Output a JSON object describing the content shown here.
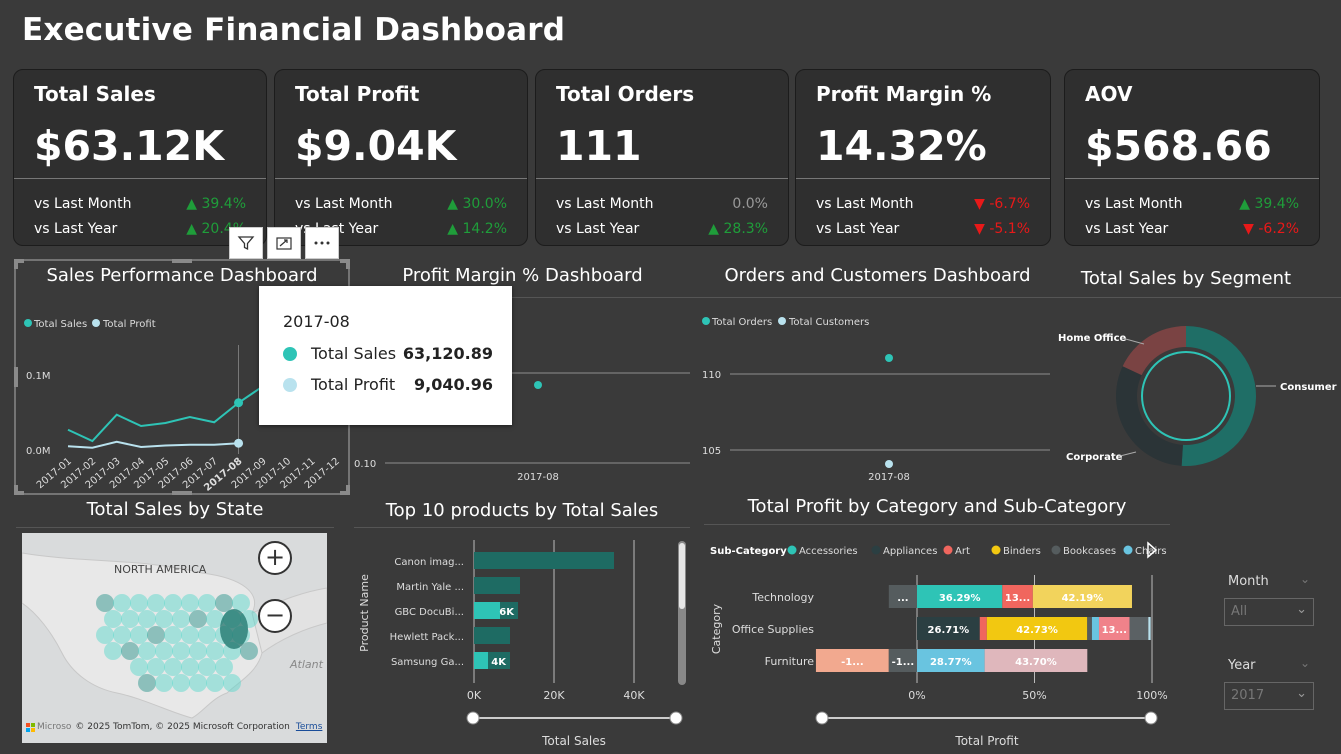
{
  "page_title": "Executive Financial Dashboard",
  "kpis": [
    {
      "title": "Total Sales",
      "value": "$63.12K",
      "m_label": "vs Last Month",
      "m_val": "39.4%",
      "m_dir": "up",
      "y_label": "vs Last Year",
      "y_val": "20.4%",
      "y_dir": "up"
    },
    {
      "title": "Total Profit",
      "value": "$9.04K",
      "m_label": "vs Last Month",
      "m_val": "30.0%",
      "m_dir": "up",
      "y_label": "vs Last Year",
      "y_val": "14.2%",
      "y_dir": "up"
    },
    {
      "title": "Total Orders",
      "value": "111",
      "m_label": "vs Last Month",
      "m_val": "0.0%",
      "m_dir": "flat",
      "y_label": "vs Last Year",
      "y_val": "28.3%",
      "y_dir": "up"
    },
    {
      "title": "Profit Margin %",
      "value": "14.32%",
      "m_label": "vs Last Month",
      "m_val": "-6.7%",
      "m_dir": "down",
      "y_label": "vs Last Year",
      "y_val": "-5.1%",
      "y_dir": "down"
    },
    {
      "title": "AOV",
      "value": "$568.66",
      "m_label": "vs Last Month",
      "m_val": "39.4%",
      "m_dir": "up",
      "y_label": "vs Last Year",
      "y_val": "-6.2%",
      "y_dir": "down"
    }
  ],
  "sections": {
    "sales_perf": "Sales Performance Dashboard",
    "profit_margin": "Profit Margin % Dashboard",
    "orders_customers": "Orders and Customers Dashboard",
    "segment": "Total Sales by Segment",
    "state": "Total Sales by State",
    "top10": "Top 10 products by Total Sales",
    "category": "Total Profit by Category and Sub-Category"
  },
  "tooltip": {
    "header": "2017-08",
    "rows": [
      {
        "name": "Total Sales",
        "value": "63,120.89",
        "color": "#2ec4b6"
      },
      {
        "name": "Total Profit",
        "value": "9,040.96",
        "color": "#b9e2ee"
      }
    ]
  },
  "visual_header_icons": [
    "filter-icon",
    "focus-mode-icon",
    "more-options-icon"
  ],
  "colors": {
    "teal": "#2ec4b6",
    "light_blue": "#b9e2ee",
    "dark_teal": "#1e6b63",
    "up": "#1f9d3a",
    "down": "#e81919"
  },
  "chart_data": [
    {
      "type": "line",
      "id": "sales_performance",
      "legend": [
        "Total Sales",
        "Total Profit"
      ],
      "categories": [
        "2017-01",
        "2017-02",
        "2017-03",
        "2017-04",
        "2017-05",
        "2017-06",
        "2017-07",
        "2017-08",
        "2017-09",
        "2017-10",
        "2017-11",
        "2017-12"
      ],
      "y_ticks": [
        "0.0M",
        "0.1M"
      ],
      "ylim": [
        0,
        0.12
      ],
      "series": [
        {
          "name": "Total Sales",
          "values": [
            0.027,
            0.012,
            0.047,
            0.032,
            0.036,
            0.044,
            0.037,
            0.063,
            0.085,
            null,
            null,
            null
          ]
        },
        {
          "name": "Total Profit",
          "values": [
            0.005,
            0.003,
            0.011,
            0.004,
            0.006,
            0.007,
            0.007,
            0.009,
            null,
            null,
            null,
            null
          ]
        }
      ]
    },
    {
      "type": "scatter",
      "id": "profit_margin",
      "categories": [
        "2017-08"
      ],
      "y_ticks": [
        "0.10"
      ],
      "values": [
        0.1432
      ]
    },
    {
      "type": "scatter",
      "id": "orders_customers",
      "legend": [
        "Total Orders",
        "Total Customers"
      ],
      "categories": [
        "2017-08"
      ],
      "y_ticks": [
        "110",
        "105"
      ],
      "series": [
        {
          "name": "Total Orders",
          "values": [
            111
          ]
        },
        {
          "name": "Total Customers",
          "values": [
            104
          ]
        }
      ]
    },
    {
      "type": "pie",
      "id": "segment",
      "labels": [
        "Consumer",
        "Corporate",
        "Home Office"
      ],
      "values": [
        51,
        31,
        18
      ],
      "colors": [
        "#1f6e66",
        "#2b3437",
        "#7a4343"
      ]
    },
    {
      "type": "bar",
      "id": "top10",
      "orientation": "horizontal",
      "ylabel": "Product Name",
      "xlabel": "Total Sales",
      "x_ticks": [
        "0K",
        "20K",
        "40K"
      ],
      "xlim": [
        0,
        45000
      ],
      "categories": [
        "Canon imag...",
        "Martin Yale ...",
        "GBC DocuBi...",
        "Hewlett Pack...",
        "Samsung Ga..."
      ],
      "values": [
        35000,
        11500,
        11000,
        9000,
        9000
      ],
      "data_labels": [
        "",
        "",
        "6K",
        "",
        "4K"
      ]
    },
    {
      "type": "bar",
      "id": "category",
      "orientation": "horizontal-stacked-100",
      "ylabel": "Category",
      "xlabel": "Total Profit",
      "x_ticks": [
        "0%",
        "50%",
        "100%"
      ],
      "legend_title": "Sub-Category",
      "legend": [
        {
          "name": "Accessories",
          "color": "#2ec4b6"
        },
        {
          "name": "Appliances",
          "color": "#2b3f42"
        },
        {
          "name": "Art",
          "color": "#f0665e"
        },
        {
          "name": "Binders",
          "color": "#f2c811"
        },
        {
          "name": "Bookcases",
          "color": "#555c5e"
        },
        {
          "name": "Chairs",
          "color": "#69c4e0"
        }
      ],
      "categories": [
        "Technology",
        "Office Supplies",
        "Furniture"
      ],
      "rows": [
        [
          {
            "pct": -12,
            "color": "#555c5e",
            "label": "..."
          },
          {
            "pct": 36.29,
            "color": "#2ec4b6",
            "label": "36.29%"
          },
          {
            "pct": 13,
            "color": "#f0665e",
            "label": "13..."
          },
          {
            "pct": 42.19,
            "color": "#f2d35c",
            "label": "42.19%"
          }
        ],
        [
          {
            "pct": 26.71,
            "color": "#2b3f42",
            "label": "26.71%"
          },
          {
            "pct": 3,
            "color": "#f0665e",
            "label": ""
          },
          {
            "pct": 42.73,
            "color": "#f2c811",
            "label": "42.73%"
          },
          {
            "pct": 2,
            "color": "#555c5e",
            "label": ""
          },
          {
            "pct": 3,
            "color": "#69c4e0",
            "label": ""
          },
          {
            "pct": 13,
            "color": "#f0828a",
            "label": "13..."
          },
          {
            "pct": 8,
            "color": "#5b6164",
            "label": ""
          },
          {
            "pct": 1,
            "color": "#b9e2ee",
            "label": ""
          }
        ],
        [
          {
            "pct": -31,
            "color": "#f2a98f",
            "label": "-1..."
          },
          {
            "pct": -12,
            "color": "#555c5e",
            "label": "-1..."
          },
          {
            "pct": 28.77,
            "color": "#69c4e0",
            "label": "28.77%"
          },
          {
            "pct": 43.7,
            "color": "#dfb7bc",
            "label": "43.70%"
          }
        ]
      ]
    }
  ],
  "map": {
    "region_label": "NORTH AMERICA",
    "ocean_label": "Atlant",
    "copyright": "© 2025 TomTom, © 2025 Microsoft Corporation",
    "terms": "Terms",
    "logo_text": "Microso",
    "zoom_in": "+",
    "zoom_out": "−"
  },
  "slicers": [
    {
      "label": "Month",
      "value": "All"
    },
    {
      "label": "Year",
      "value": "2017"
    }
  ]
}
